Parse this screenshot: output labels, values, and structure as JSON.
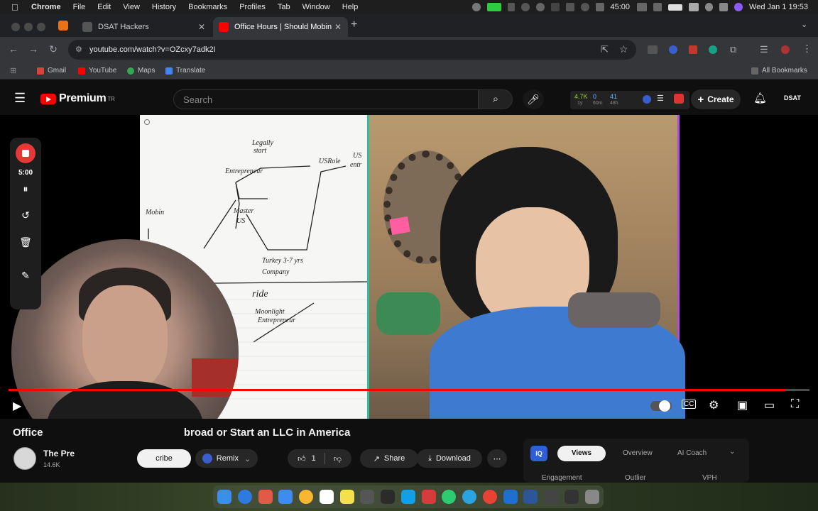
{
  "menubar": {
    "app": "Chrome",
    "items": [
      "File",
      "Edit",
      "View",
      "History",
      "Bookmarks",
      "Profiles",
      "Tab",
      "Window",
      "Help"
    ],
    "timer": "45:00",
    "clock": "Wed Jan 1  19:53"
  },
  "tabs": [
    {
      "label": "DSAT Hackers",
      "active": false
    },
    {
      "label": "Office Hours | Should Mobin S",
      "active": true
    }
  ],
  "address": {
    "url": "youtube.com/watch?v=OZcxy7adk2I"
  },
  "bookmarks": {
    "items": [
      "Gmail",
      "YouTube",
      "Maps",
      "Translate"
    ],
    "all": "All Bookmarks"
  },
  "youtube": {
    "logo_text": "Premium",
    "logo_region": "TR",
    "search_placeholder": "Search",
    "stats": {
      "views": "4.7K",
      "likes": "0",
      "other": "41",
      "sub1": "1y",
      "sub2": "60m",
      "sub3": "48h"
    },
    "create_label": "Create",
    "account_label": "DSAT"
  },
  "recorder": {
    "time": "5:00"
  },
  "player": {
    "progress": 0.97
  },
  "video": {
    "title_left": "Office",
    "title_right": "broad or Start an LLC in America",
    "channel": "The Pre",
    "subscribers": "14.6K",
    "subscribe_label": "cribe",
    "remix_label": "Remix",
    "likes": "1",
    "share_label": "Share",
    "download_label": "Download"
  },
  "iq_panel": {
    "badge": "IQ",
    "tabs": [
      "Views",
      "Overview",
      "AI Coach"
    ],
    "columns": [
      "Engagement",
      "Outlier",
      "VPH"
    ]
  },
  "whiteboard": {
    "notes": [
      "Legally",
      "start",
      "Entrepreneur",
      "USRole",
      "US",
      "entr",
      "Mobin",
      "Master",
      "US",
      "Turkey 3-7 yrs",
      "Company",
      "ride",
      "Moonlight",
      "Entrepreneur"
    ]
  }
}
